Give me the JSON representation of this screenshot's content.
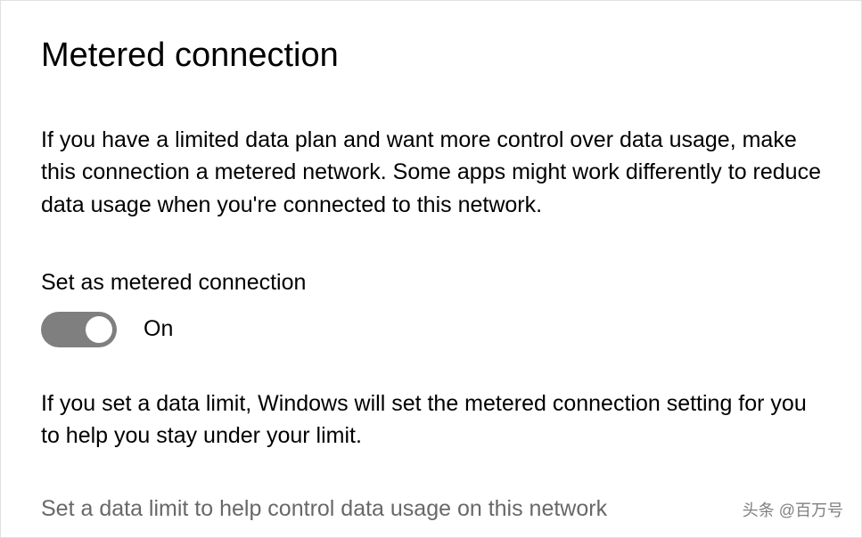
{
  "page": {
    "title": "Metered connection",
    "description": "If you have a limited data plan and want more control over data usage, make this connection a metered network. Some apps might work differently to reduce data usage when you're connected to this network.",
    "toggle": {
      "label": "Set as metered connection",
      "state": "On",
      "enabled": true
    },
    "limit_description": "If you set a data limit, Windows will set the metered connection setting for you to help you stay under your limit.",
    "link": "Set a data limit to help control data usage on this network"
  },
  "watermark": "头条 @百万号"
}
